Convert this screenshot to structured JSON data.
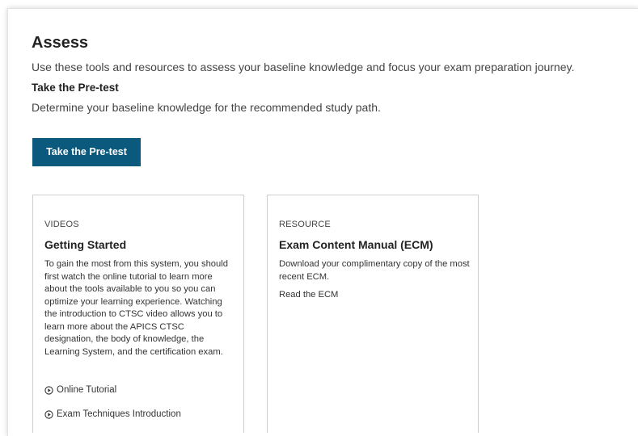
{
  "assess": {
    "title": "Assess",
    "intro": "Use these tools and resources to assess your baseline knowledge and focus your exam preparation journey.",
    "pretest_heading": "Take the Pre-test",
    "pretest_desc": "Determine your baseline knowledge for the recommended study path.",
    "pretest_button": "Take the Pre-test"
  },
  "cards": {
    "videos": {
      "kicker": "VIDEOS",
      "title": "Getting Started",
      "desc": "To gain the most from this system, you should first watch the online tutorial to learn more about the tools available to you so you can optimize your learning experience. Watching the introduction to CTSC video allows you to learn more about the APICS CTSC designation, the body of knowledge, the Learning System, and the certification exam.",
      "links": [
        {
          "label": "Online Tutorial",
          "icon": "play-circle-icon"
        },
        {
          "label": "Exam Techniques Introduction",
          "icon": "play-circle-icon"
        }
      ]
    },
    "resource": {
      "kicker": "RESOURCE",
      "title": "Exam Content Manual (ECM)",
      "desc": "Download your complimentary copy of the most recent ECM.",
      "link": "Read the ECM"
    }
  },
  "colors": {
    "button_bg": "#0b5a7e",
    "button_text": "#ffffff",
    "card_border": "#cfcfcf"
  }
}
